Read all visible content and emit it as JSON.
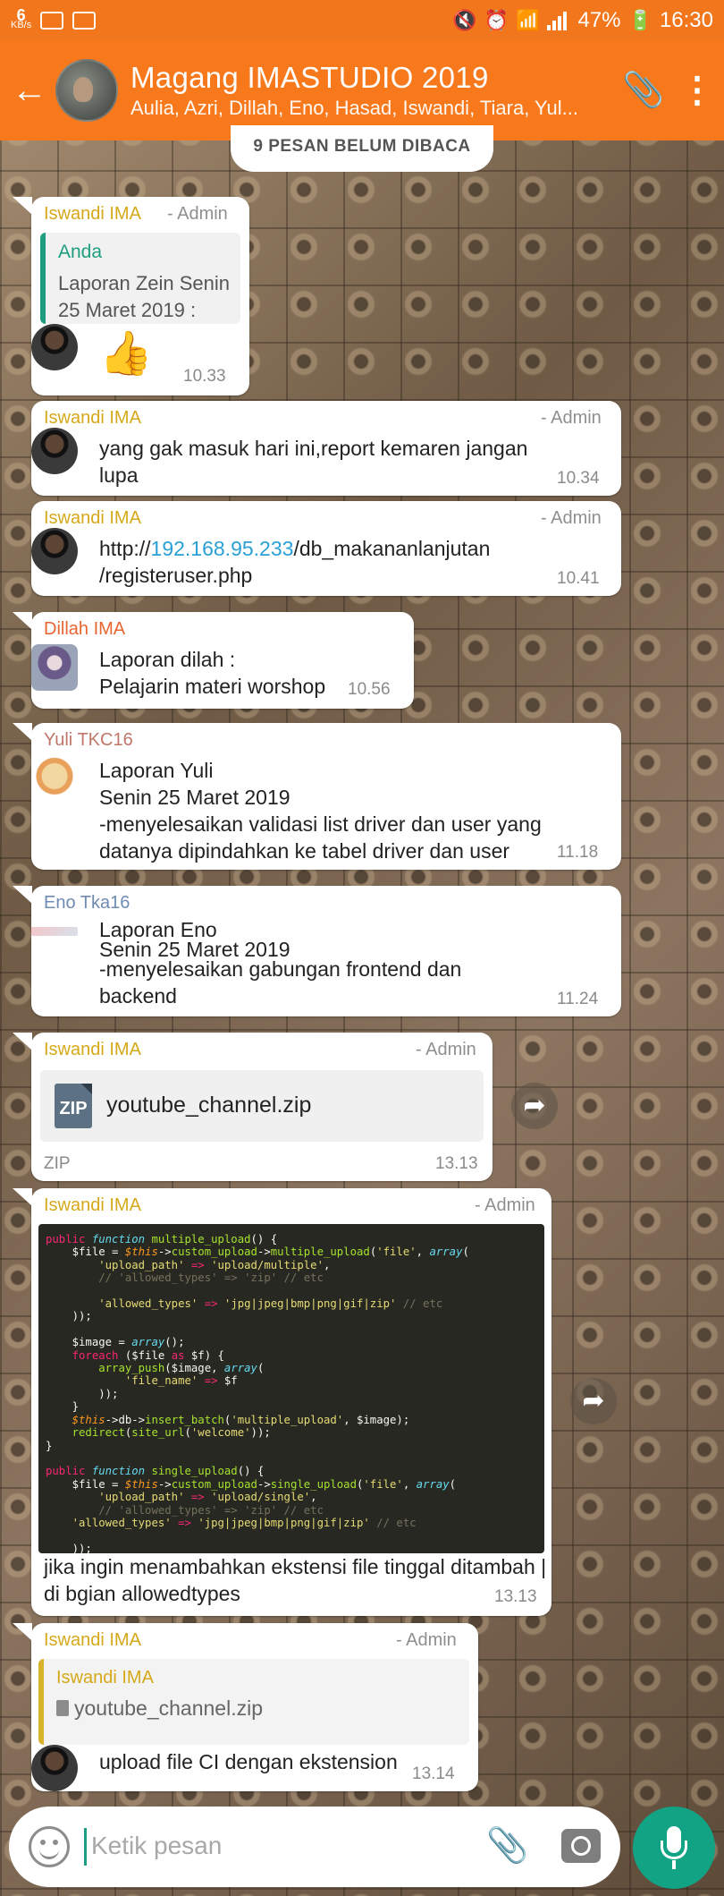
{
  "status": {
    "speed_value": "6",
    "speed_unit": "KB/s",
    "battery": "47%",
    "time": "16:30"
  },
  "header": {
    "title": "Magang IMASTUDIO 2019",
    "subtitle": "Aulia, Azri, Dillah, Eno, Hasad, Iswandi, Tiara, Yul..."
  },
  "unread_banner": "9 PESAN BELUM DIBACA",
  "colors": {
    "accent": "#f7791c",
    "iswandi": "#d5a91a",
    "dillah": "#e8652f",
    "yuli": "#c0776a",
    "eno": "#6e8cb3"
  },
  "messages": [
    {
      "sender": "Iswandi IMA",
      "role": "- Admin",
      "quote_name": "Anda",
      "quote_text": "Laporan Zein Senin 25 Maret 2019 :",
      "body": "👍",
      "time": "10.33"
    },
    {
      "sender": "Iswandi IMA",
      "role": "- Admin",
      "body_line1": "yang gak masuk hari ini,report kemaren jangan",
      "body_line2": "lupa",
      "time": "10.34"
    },
    {
      "sender": "Iswandi IMA",
      "role": "- Admin",
      "link_pre": "http://",
      "link_ip": "192.168.95.233",
      "link_post": "/db_makananlanjutan",
      "link_line2": "/registeruser.php",
      "time": "10.41"
    },
    {
      "sender": "Dillah IMA",
      "body_line1": "Laporan dilah :",
      "body_line2": "Pelajarin materi worshop",
      "time": "10.56"
    },
    {
      "sender": "Yuli TKC16",
      "body_line1": "Laporan Yuli",
      "body_line2": "Senin 25 Maret 2019",
      "body_line3": "-menyelesaikan validasi list driver dan user yang",
      "body_line4": "datanya dipindahkan ke tabel driver dan user",
      "time": "11.18"
    },
    {
      "sender": "Eno Tka16",
      "body_line1": "Laporan Eno",
      "body_line1b": "Senin 25 Maret 2019",
      "body_line2": "-menyelesaikan gabungan frontend dan",
      "body_line3": "backend",
      "time": "11.24"
    },
    {
      "sender": "Iswandi IMA",
      "role": "- Admin",
      "file_name": "youtube_channel.zip",
      "file_icon": "ZIP",
      "file_type": "ZIP",
      "time": "13.13"
    },
    {
      "sender": "Iswandi IMA",
      "role": "- Admin",
      "caption_line1": "jika ingin menambahkan ekstensi file tinggal ditambah |",
      "caption_line2": "di bgian allowedtypes",
      "time": "13.13"
    },
    {
      "sender": "Iswandi IMA",
      "role": "- Admin",
      "quote_name": "Iswandi IMA",
      "quote_file": "youtube_channel.zip",
      "body": "upload file CI dengan ekstension",
      "time": "13.14"
    }
  ],
  "composer": {
    "placeholder": "Ketik pesan"
  }
}
